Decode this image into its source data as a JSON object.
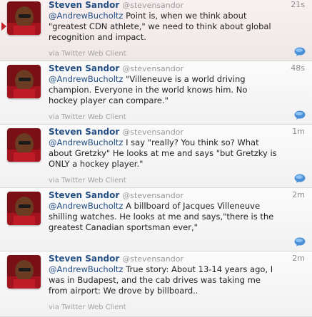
{
  "avatar_alt": "Steven Sandor avatar",
  "tweets": [
    {
      "name": "Steven Sandor",
      "handle": "@stevensandor",
      "time": "21s",
      "mention": "@AndrewBucholtz",
      "body": " Point is, when we think about\n\"greatest CDN athlete,\" we need to think about global\nrecognition and impact.",
      "via": "via Twitter Web Client"
    },
    {
      "name": "Steven Sandor",
      "handle": "@stevensandor",
      "time": "48s",
      "mention": "@AndrewBucholtz",
      "body": " \"Villeneuve is a world driving\nchampion. Everyone in the world knows him. No\nhockey player can compare.\"",
      "via": "via Twitter Web Client"
    },
    {
      "name": "Steven Sandor",
      "handle": "@stevensandor",
      "time": "1m",
      "mention": "@AndrewBucholtz",
      "body": " I say \"really? You think so? What\nabout Gretzky\" He looks at me and says \"but Gretzky is\nONLY a hockey player.\"",
      "via": "via Twitter Web Client"
    },
    {
      "name": "Steven Sandor",
      "handle": "@stevensandor",
      "time": "2m",
      "mention": "@AndrewBucholtz",
      "body": " A billboard of Jacques Villeneuve\nshilling watches. He looks at me and says,\"there is the\ngreatest Canadian sportsman ever,\"",
      "via": "via Twitter Web Client"
    },
    {
      "name": "Steven Sandor",
      "handle": "@stevensandor",
      "time": "2m",
      "mention": "@AndrewBucholtz",
      "body": " True story: About 13-14 years ago, I\nwas in Budapest, and the cab drives was taking me\nfrom airport: We drove by billboard..",
      "via": "via Twitter Web Client"
    }
  ]
}
